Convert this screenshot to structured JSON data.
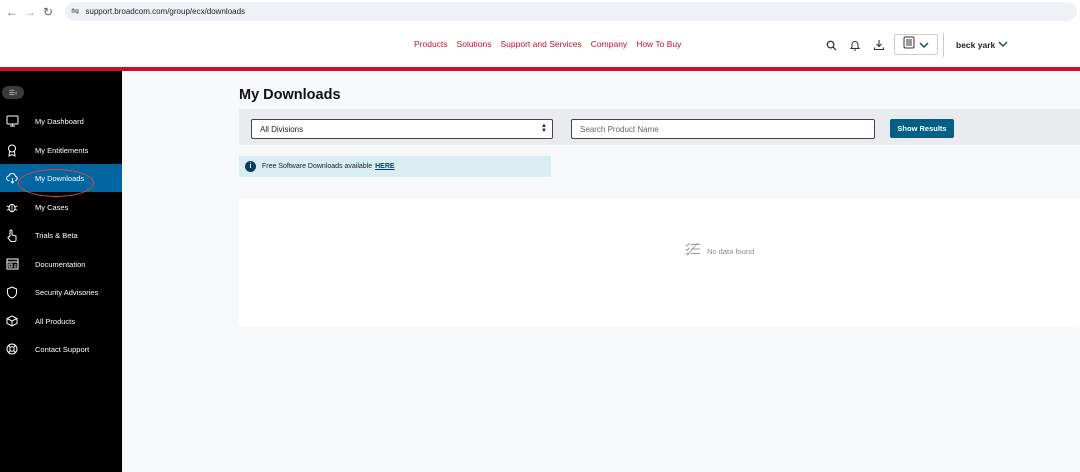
{
  "browser": {
    "url": "support.broadcom.com/group/ecx/downloads"
  },
  "header": {
    "nav": [
      "Products",
      "Solutions",
      "Support and Services",
      "Company",
      "How To Buy"
    ],
    "user_name": "beck yark",
    "accent_color": "#c8102e"
  },
  "sidebar": {
    "items": [
      {
        "label": "My Dashboard",
        "icon": "monitor-icon"
      },
      {
        "label": "My Entitlements",
        "icon": "award-icon"
      },
      {
        "label": "My Downloads",
        "icon": "cloud-download-icon",
        "active": true
      },
      {
        "label": "My Cases",
        "icon": "bug-icon"
      },
      {
        "label": "Trials & Beta",
        "icon": "hand-pointer-icon"
      },
      {
        "label": "Documentation",
        "icon": "book-icon"
      },
      {
        "label": "Security Advisories",
        "icon": "shield-icon"
      },
      {
        "label": "All Products",
        "icon": "cube-icon"
      },
      {
        "label": "Contact Support",
        "icon": "lifebuoy-icon"
      }
    ]
  },
  "main": {
    "title": "My Downloads",
    "division_select": "All Divisions",
    "search_placeholder": "Search Product Name",
    "show_button": "Show Results",
    "info_text": "Free Software Downloads available",
    "info_link": "HERE",
    "empty_text": "No data found"
  }
}
